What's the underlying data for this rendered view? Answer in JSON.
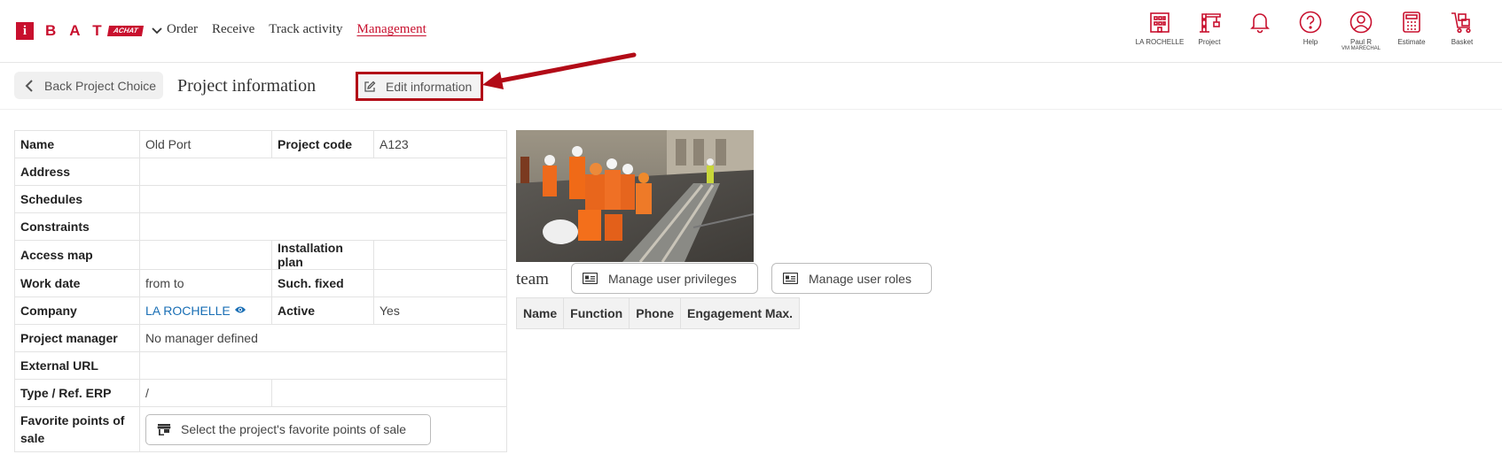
{
  "header": {
    "logo_letter": "i",
    "logo_text": "BAT",
    "logo_badge": "ACHAT",
    "nav": [
      {
        "label": "Order"
      },
      {
        "label": "Receive"
      },
      {
        "label": "Track activity"
      },
      {
        "label": "Management"
      }
    ],
    "active_nav": "Management",
    "icons": [
      {
        "icon": "building-icon",
        "label": "LA ROCHELLE"
      },
      {
        "icon": "crane-icon",
        "label": "Project"
      },
      {
        "icon": "bell-icon",
        "label": ""
      },
      {
        "icon": "help-icon",
        "label": "Help"
      },
      {
        "icon": "user-icon",
        "label": "Paul R",
        "sublabel": "VM MARECHAL"
      },
      {
        "icon": "calculator-icon",
        "label": "Estimate"
      },
      {
        "icon": "basket-icon",
        "label": "Basket"
      }
    ]
  },
  "subbar": {
    "back_label": "Back Project Choice",
    "title": "Project information",
    "edit_label": "Edit information"
  },
  "info": {
    "name_key": "Name",
    "name_val": "Old Port",
    "code_key": "Project code",
    "code_val": "A123",
    "address_key": "Address",
    "schedules_key": "Schedules",
    "constraints_key": "Constraints",
    "access_key": "Access map",
    "install_key": "Installation plan",
    "workdate_key": "Work date",
    "workdate_val": "from to",
    "fixed_key": "Such. fixed",
    "company_key": "Company",
    "company_val": "LA ROCHELLE",
    "active_key": "Active",
    "active_val": "Yes",
    "pm_key": "Project manager",
    "pm_val": "No manager defined",
    "url_key": "External URL",
    "type_key": "Type / Ref. ERP",
    "type_val": "/",
    "fav_key": "Favorite points of sale",
    "fav_button": "Select the project's favorite points of sale"
  },
  "team": {
    "label": "team",
    "privileges_button": "Manage user privileges",
    "roles_button": "Manage user roles",
    "columns": [
      "Name",
      "Function",
      "Phone",
      "Engagement Max."
    ]
  },
  "colors": {
    "brand": "#c8102e",
    "link": "#1a6fb5",
    "highlight": "#b20b17"
  }
}
